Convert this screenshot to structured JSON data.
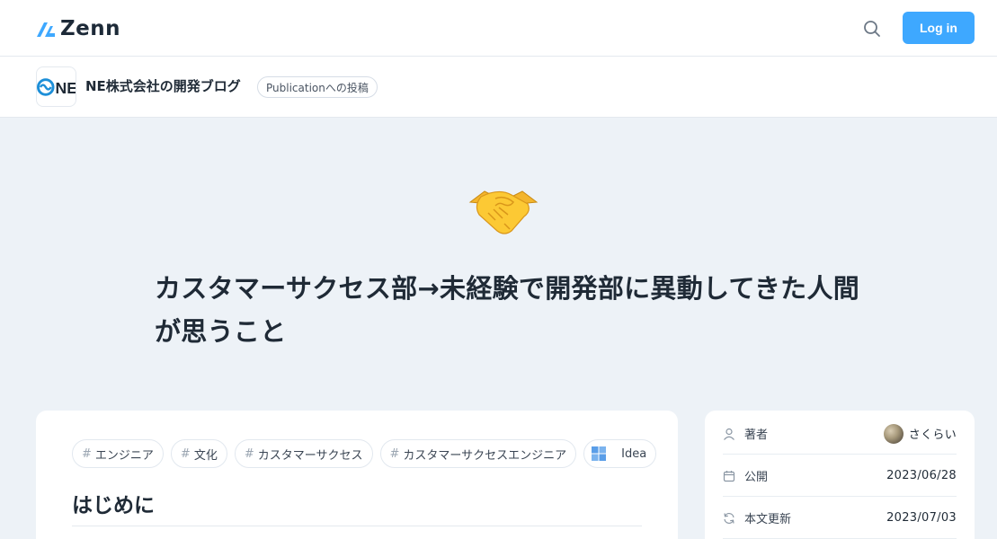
{
  "header": {
    "logo_text": "Zenn",
    "login_label": "Log in",
    "search_icon": "search-icon"
  },
  "publication": {
    "logo_text": "NE",
    "name": "NE株式会社の開発ブログ",
    "badge": "Publicationへの投稿"
  },
  "article": {
    "emoji": "handshake",
    "title": "カスタマーサクセス部→未経験で開発部に異動してきた人間が思うこと",
    "tags": [
      {
        "label": "エンジニア"
      },
      {
        "label": "文化"
      },
      {
        "label": "カスタマーサクセス"
      },
      {
        "label": "カスタマーサクセスエンジニア"
      }
    ],
    "type_label": "Idea",
    "first_heading": "はじめに"
  },
  "sidebar": {
    "author_label": "著者",
    "author_name": "さくらい",
    "published_label": "公開",
    "published_date": "2023/06/28",
    "updated_label": "本文更新",
    "updated_date": "2023/07/03"
  },
  "colors": {
    "accent": "#3ea8ff",
    "background": "#edf2f7"
  }
}
